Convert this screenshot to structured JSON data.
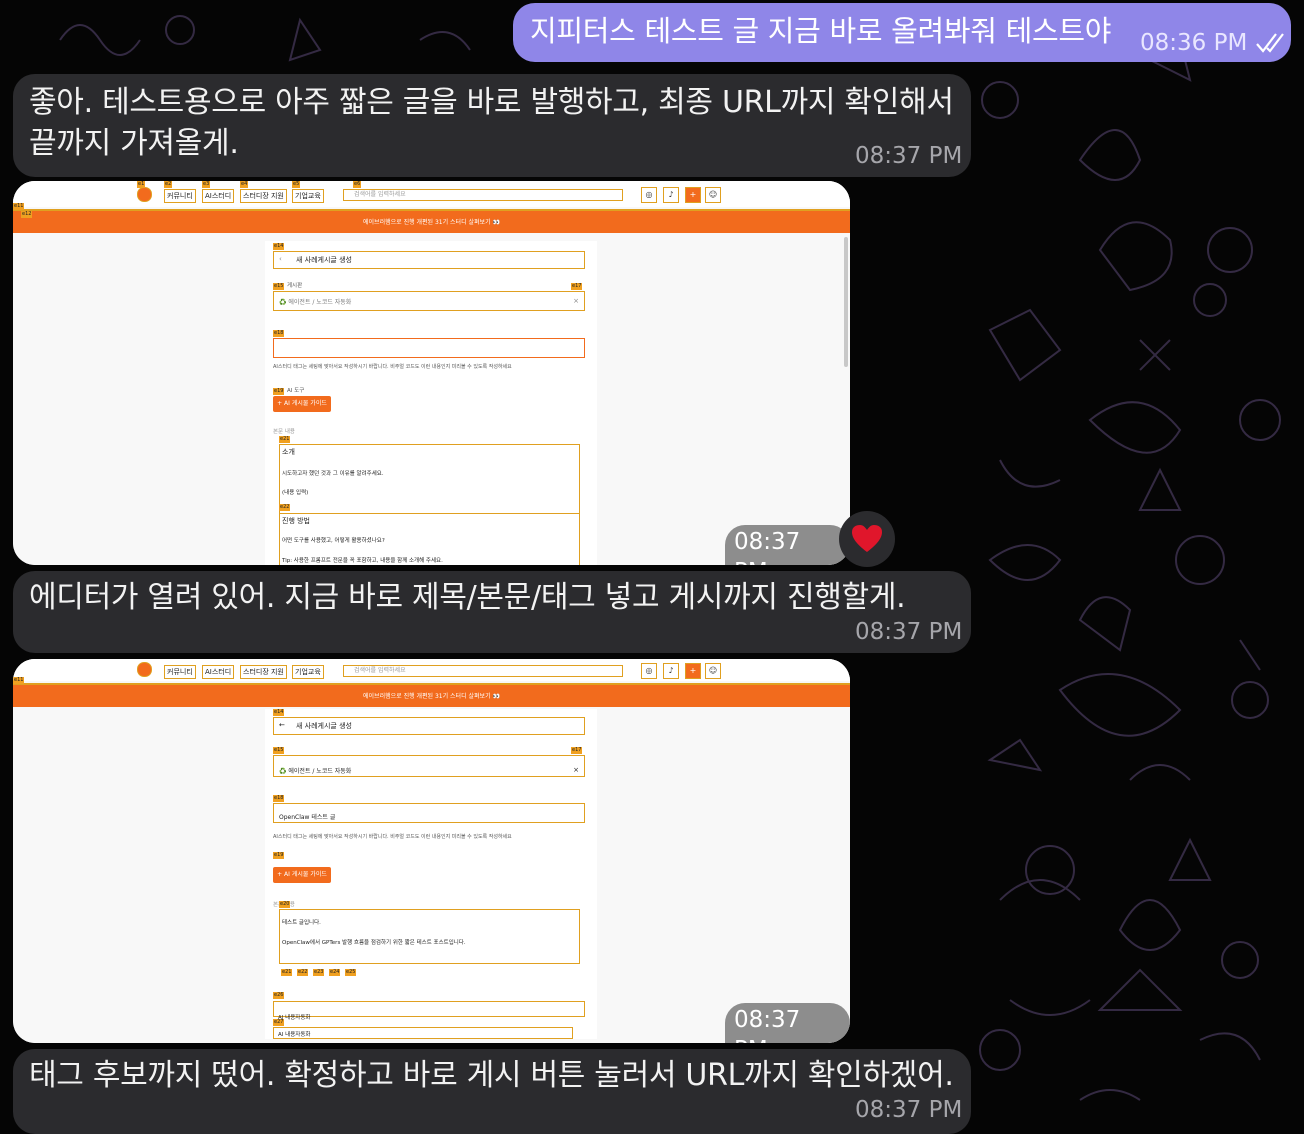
{
  "messages": [
    {
      "direction": "out",
      "text": "지피터스 테스트 글 지금 바로 올려봐줘 테스트야",
      "time": "08:36 PM",
      "status": "read"
    },
    {
      "direction": "in",
      "text_lines": [
        "좋아. 테스트용으로 아주 짧은 글을 바로 발행하고, 최종 URL까지 확인해서",
        "끝까지 가져올게."
      ],
      "time": "08:37 PM"
    },
    {
      "direction": "in",
      "type": "photo",
      "time": "08:37 PM",
      "reaction": "heart"
    },
    {
      "direction": "in",
      "text": "에디터가 열려 있어. 지금 바로 제목/본문/태그 넣고 게시까지 진행할게.",
      "time": "08:37 PM"
    },
    {
      "direction": "in",
      "type": "photo",
      "time": "08:37 PM"
    },
    {
      "direction": "in",
      "text": "태그 후보까지 떴어. 확정하고 바로 게시 버튼 눌러서 URL까지 확인하겠어.",
      "time": "08:37 PM"
    }
  ],
  "screenshot1": {
    "nav": [
      "커뮤니티",
      "AI스터디",
      "스터디장 지원",
      "기업교육"
    ],
    "search_placeholder": "검색어를 입력하세요",
    "banner": "에이브러햄으로 진행 개편된 31기 스터디 살펴보기 👀",
    "page_title": "새 사례게시글 생성",
    "board_label": "게시판",
    "board_value": "♻️ 에이전트 / 노코드 자동화",
    "helper": "AI스터디 태그는 세팅에 맞아서요 작성하시기 바랍니다. 비주얼 코드도 이런 내용인지 미리볼 수 있도록 작성하세요",
    "ai_tool_label": "AI 도구",
    "ai_button": "+ AI 게시물 가이드",
    "body_label": "본문 내용",
    "section1": "소개",
    "line1": "시도하고자 했던 것과 그 이유를 알려주세요.",
    "line2": "(내용 입력)",
    "section2": "진행 방법",
    "line3": "어떤 도구를 사용했고, 어떻게 활용하셨나요?",
    "line4": "Tip: 사용한 프롬프트 전문을 꼭 포함하고, 내용을 함께 소개해 주세요.",
    "badges": {
      "e1": "e1",
      "e2": "e2",
      "e3": "e3",
      "e4": "e4",
      "e5": "e5",
      "e6": "e6",
      "e11": "e11",
      "e12": "e12",
      "e14": "e14",
      "e15": "e15",
      "e17": "e17",
      "e18": "e18",
      "e19": "e19",
      "e21": "e21",
      "e22": "e22"
    }
  },
  "screenshot2": {
    "nav": [
      "커뮤니티",
      "AI스터디",
      "스터디장 지원",
      "기업교육"
    ],
    "search_placeholder": "검색어를 입력하세요",
    "banner": "에이브러햄으로 진행 개편된 31기 스터디 살펴보기 👀",
    "page_title": "새 사례게시글 생성",
    "board_label": "게시판",
    "board_value": "♻️ 에이전트 / 노코드 자동화",
    "title_label": "제목",
    "title_value": "OpenClaw 테스트 글",
    "helper": "AI스터디 태그는 세팅에 맞아서요 작성하시기 바랍니다. 비주얼 코드도 이런 내용인지 미리볼 수 있도록 작성하세요",
    "ai_tool_label": "AI 도구",
    "ai_button": "+ AI 게시물 가이드",
    "body_label": "본문 내용",
    "line1": "테스트 글입니다.",
    "line2": "OpenClaw에서 GPTers 발행 흐름을 점검하기 위한 짧은 테스트 포스트입니다.",
    "tag1": "AI 내용자동화",
    "tag2": "AI 내용자동화",
    "badges": {
      "e1": "e1",
      "e2": "e2",
      "e3": "e3",
      "e4": "e4",
      "e5": "e5",
      "e6": "e6",
      "e11": "e11",
      "e12": "e12",
      "e14": "e14",
      "e15": "e15",
      "e17": "e17",
      "e18": "e18",
      "e19": "e19",
      "e20": "e20",
      "e21": "e21",
      "e22": "e22",
      "e23": "e23",
      "e24": "e24",
      "e25": "e25",
      "e26": "e26",
      "e27": "e27"
    }
  },
  "colors": {
    "outgoing": "#8f86e8",
    "incoming": "#2b2b2e",
    "background": "#050505",
    "accent": "#f26b1d"
  }
}
